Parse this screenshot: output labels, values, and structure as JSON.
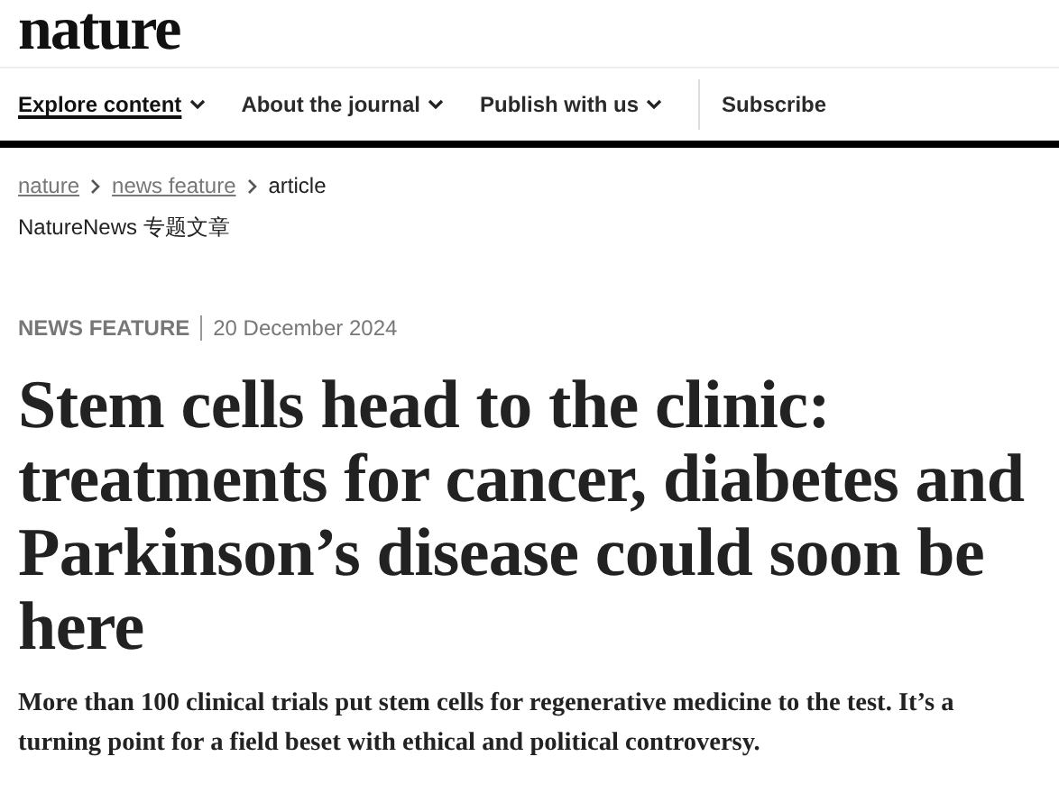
{
  "logo": "nature",
  "nav": [
    {
      "label": "Explore content",
      "dropdown": true,
      "selected": true
    },
    {
      "label": "About the journal",
      "dropdown": true,
      "selected": false
    },
    {
      "label": "Publish with us",
      "dropdown": true,
      "selected": false
    },
    {
      "label": "Subscribe",
      "dropdown": false,
      "selected": false
    }
  ],
  "breadcrumb": [
    {
      "label": "nature",
      "kind": "link"
    },
    {
      "label": "news feature",
      "kind": "link"
    },
    {
      "label": "article",
      "kind": "current"
    }
  ],
  "subtitle": "NatureNews 专题文章",
  "article_type": "NEWS FEATURE",
  "date": "20 December 2024",
  "title": "Stem cells head to the clinic: treatments for cancer, diabetes and Parkinson’s disease could soon be here",
  "standfirst": "More than 100 clinical trials put stem cells for regenerative medicine to the test. It’s a turning point for a field beset with ethical and political controversy."
}
